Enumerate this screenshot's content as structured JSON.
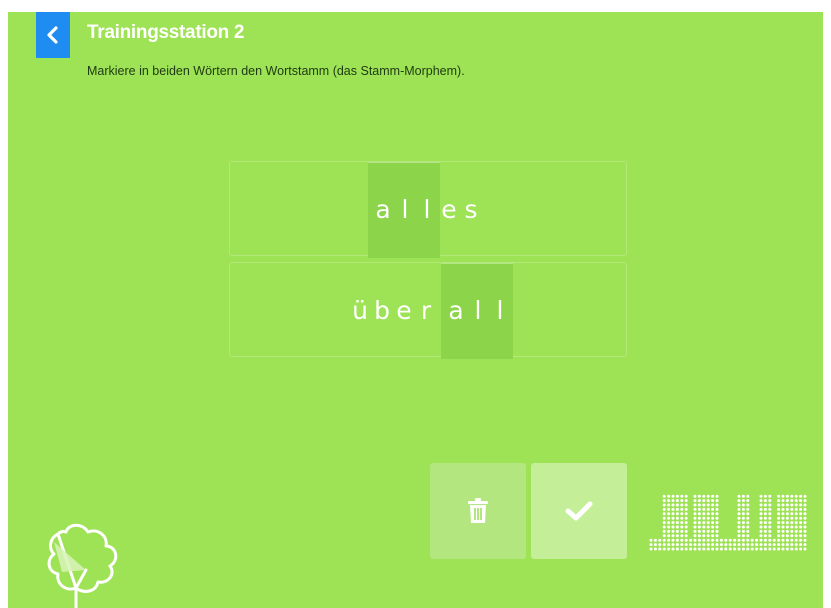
{
  "header": {
    "back_icon": "chevron-left-icon",
    "title": "Trainingsstation 2",
    "instruction": "Markiere in beiden Wörtern den Wortstamm (das Stamm-Morphem)."
  },
  "words": [
    {
      "letters": [
        "a",
        "l",
        "l",
        "e",
        "s"
      ],
      "selected": [
        "a",
        "l",
        "l"
      ]
    },
    {
      "letters": [
        "ü",
        "b",
        "e",
        "r",
        "a",
        "l",
        "l"
      ],
      "selected": [
        "a",
        "l",
        "l"
      ]
    }
  ],
  "actions": {
    "delete_icon": "trash-icon",
    "confirm_icon": "checkmark-icon"
  },
  "decor": {
    "progress_icon": "dot-matrix-progress-icon",
    "logo_icon": "tree-icon"
  },
  "colors": {
    "background": "#9ee255",
    "back_button": "#1e8cf0",
    "selection": "#8cd449",
    "trash_button": "#b3e67f",
    "check_button": "#c5ee98"
  }
}
